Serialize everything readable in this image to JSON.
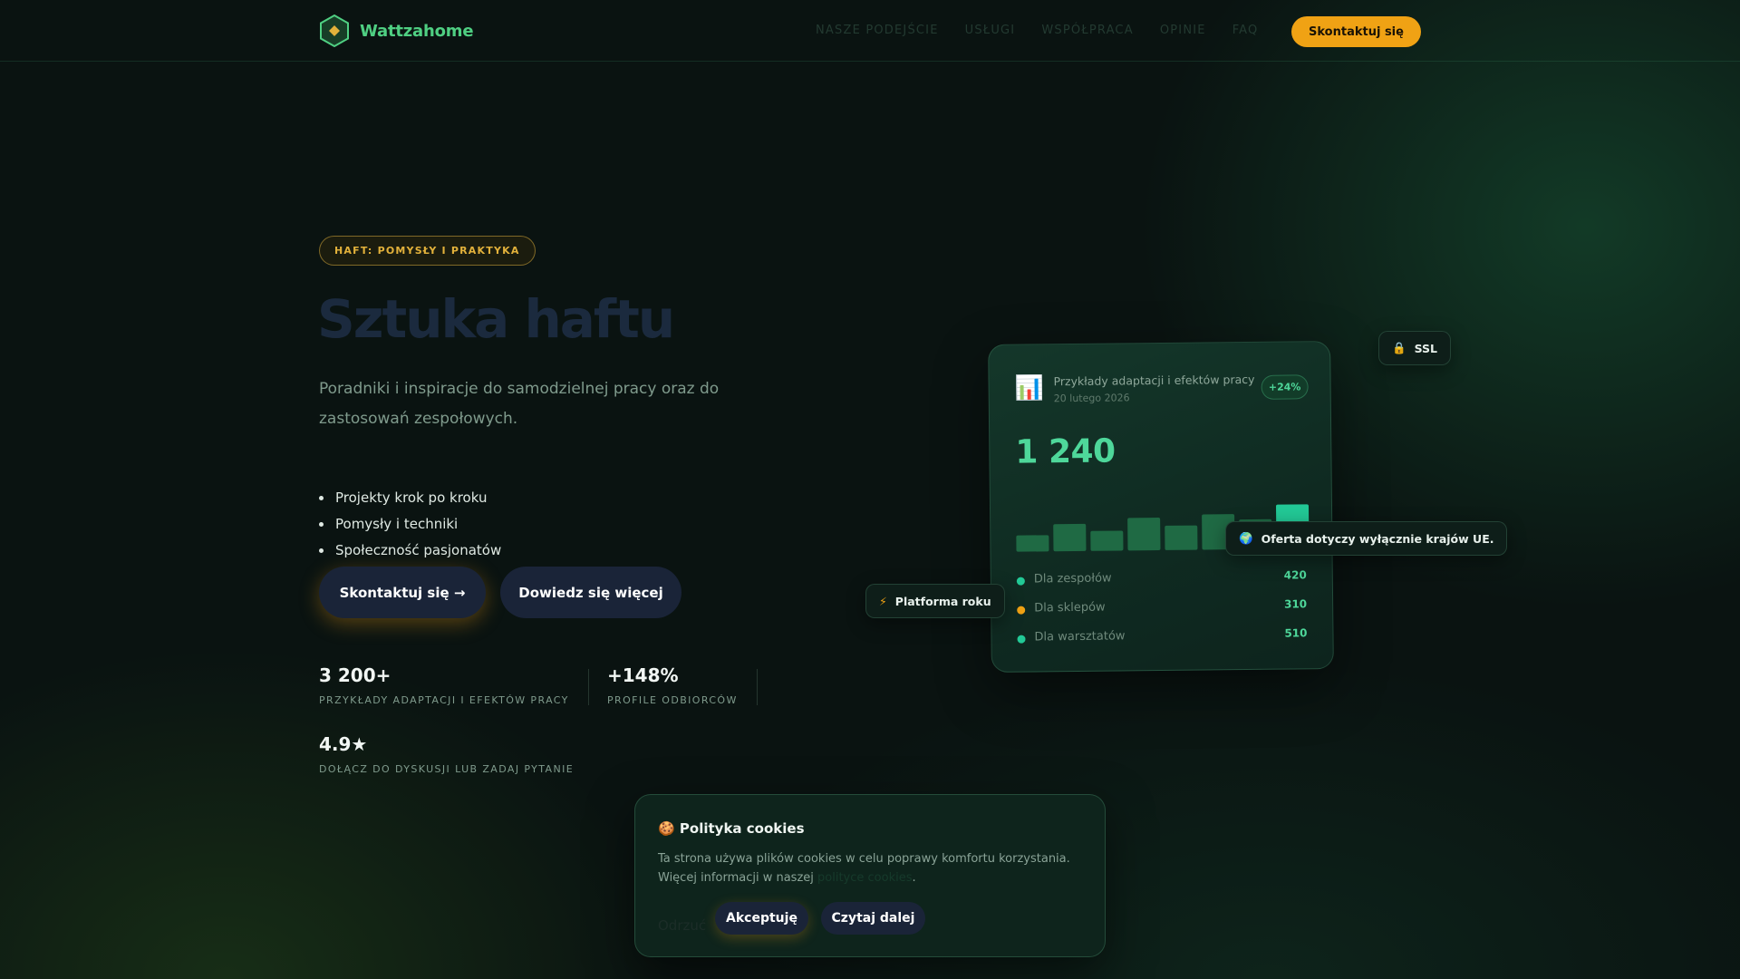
{
  "brand": {
    "name": "Wattzahome",
    "logo_icon": "hexagon-logo-icon",
    "accent": "#4fcf82"
  },
  "nav": {
    "links": [
      "NASZE PODEJŚCIE",
      "USŁUGI",
      "WSPÓŁPRACA",
      "OPINIE",
      "FAQ"
    ],
    "cta": "Skontaktuj się",
    "cta_color": "#f0a214"
  },
  "hero": {
    "eyebrow": "HAFT: POMYSŁY I PRAKTYKA",
    "title": "Sztuka haftu",
    "subtitle": "Poradniki i inspiracje do samodzielnej pracy oraz do zastosowań zespołowych.",
    "features": [
      "Projekty krok po kroku",
      "Pomysły i techniki",
      "Społeczność pasjonatów"
    ],
    "primary_button": "Skontaktuj się →",
    "secondary_button": "Dowiedz się więcej"
  },
  "stats": [
    {
      "value": "3 200+",
      "label": "PRZYKŁADY ADAPTACJI I EFEKTÓW PRACY"
    },
    {
      "value": "+148%",
      "label": "PROFILE ODBIORCÓW"
    },
    {
      "value": "4.9★",
      "label": "DOŁĄCZ DO DYSKUSJI LUB ZADAJ PYTANIE"
    }
  ],
  "card": {
    "icon": "bar-chart-icon",
    "title": "Przykłady adaptacji i efektów pracy",
    "date": "20 lutego 2026",
    "badge": "+24%",
    "value": "1 240",
    "bars": [
      0.3,
      0.5,
      0.36,
      0.6,
      0.45,
      0.65,
      0.55,
      0.82
    ],
    "rows": [
      {
        "label": "Dla zespołów",
        "value": "420",
        "dot_color": "#22c996"
      },
      {
        "label": "Dla sklepów",
        "value": "310",
        "dot_color": "#f0a214"
      },
      {
        "label": "Dla warsztatów",
        "value": "510",
        "dot_color": "#22c996"
      }
    ]
  },
  "chips": {
    "ssl": {
      "icon": "lock-icon",
      "label": "SSL"
    },
    "eu": {
      "icon": "globe-icon",
      "label": "Oferta dotyczy wyłącznie krajów UE."
    },
    "platform": {
      "icon": "lightning-icon",
      "label": "Platforma roku"
    }
  },
  "cookie": {
    "icon": "cookie-icon",
    "title": "Polityka cookies",
    "text": "Ta strona używa plików cookies w celu poprawy komfortu korzystania. Więcej informacji w naszej",
    "link": "polityce cookies",
    "decline": "Odrzuć",
    "accept": "Akceptuję",
    "more": "Czytaj dalej"
  }
}
